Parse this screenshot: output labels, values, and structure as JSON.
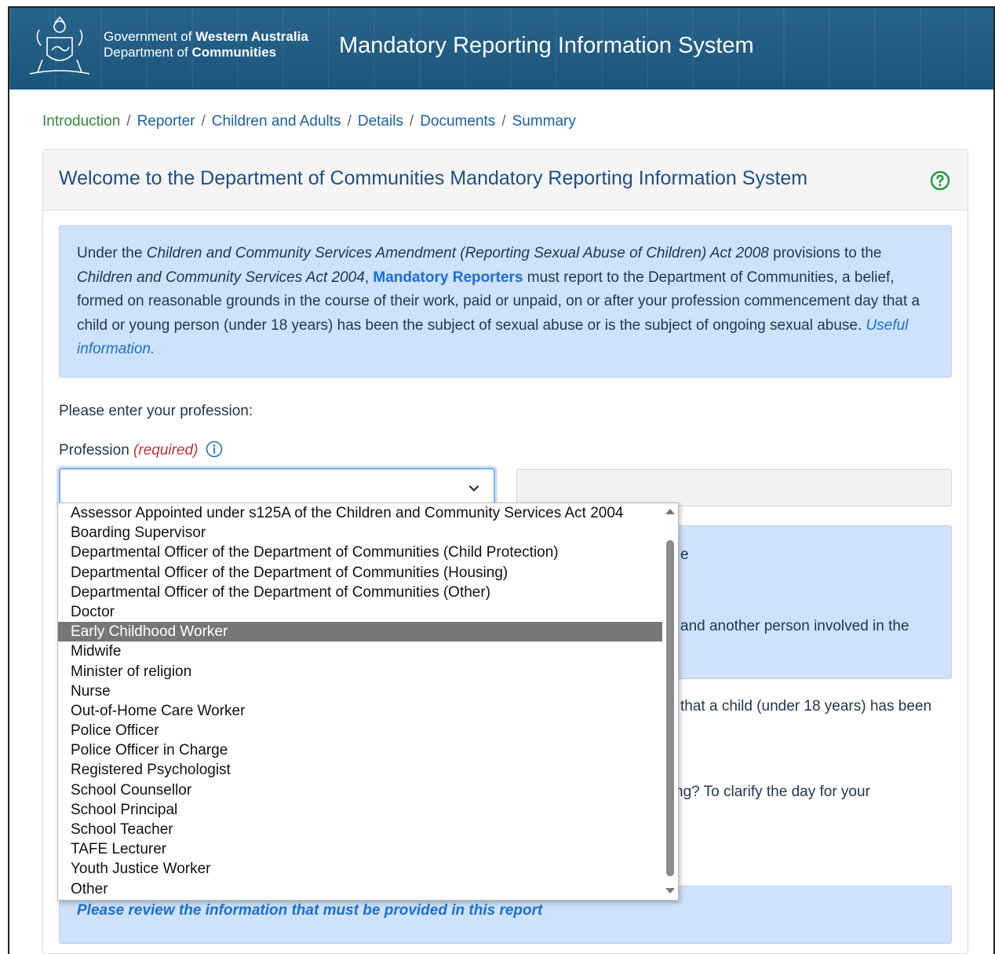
{
  "header": {
    "gov_prefix": "Government of ",
    "gov_strong": "Western Australia",
    "dept_prefix": "Department of ",
    "dept_strong": "Communities",
    "system_title": "Mandatory Reporting Information System"
  },
  "breadcrumb": [
    "Introduction",
    "Reporter",
    "Children and Adults",
    "Details",
    "Documents",
    "Summary"
  ],
  "panel": {
    "title": "Welcome to the Department of Communities Mandatory Reporting Information System"
  },
  "intro": {
    "t1": "Under the ",
    "i1": "Children and Community Services Amendment (Reporting Sexual Abuse of Children) Act 2008",
    "t2": " provisions to the ",
    "i2": "Children and Community Services Act 2004",
    "t3": ", ",
    "link1": "Mandatory Reporters",
    "t4": " must report to the Department of Communities, a belief, formed on reasonable grounds in the course of their work, paid or unpaid, on or after your profession commencement day that a child or young person (under 18 years) has been the subject of sexual abuse or is the subject of ongoing sexual abuse. ",
    "link2": "Useful information."
  },
  "form": {
    "prompt": "Please enter your profession:",
    "profession_label": "Profession ",
    "required_text": "(required)",
    "profession_value": "",
    "other_value": ""
  },
  "partial_text": {
    "p1": "e",
    "p2": "and another person involved in the",
    "p3": "that a child (under 18 years) has been",
    "p4": "ng? To clarify the day for your",
    "review": "Please review the information that must be provided in this report"
  },
  "dropdown": {
    "selected_index": 6,
    "options": [
      "Assessor Appointed under s125A of the Children and Community Services Act 2004",
      "Boarding Supervisor",
      "Departmental Officer of the Department of Communities (Child Protection)",
      "Departmental Officer of the Department of Communities (Housing)",
      "Departmental Officer of the Department of Communities (Other)",
      "Doctor",
      "Early Childhood Worker",
      "Midwife",
      "Minister of religion",
      "Nurse",
      "Out-of-Home Care Worker",
      "Police Officer",
      "Police Officer in Charge",
      "Registered Psychologist",
      "School Counsellor",
      "School Principal",
      "School Teacher",
      "TAFE Lecturer",
      "Youth Justice Worker",
      "Other"
    ]
  },
  "colors": {
    "banner": "#1f5d86",
    "link": "#1a6fd1",
    "breadcrumb_active": "#2f8a3a",
    "info_bg": "#cfe2fb",
    "required": "#c0313b",
    "selected_option": "#767676"
  },
  "icons": {
    "crest": "wa-government-crest-icon",
    "help": "help-circle-icon",
    "info": "info-circle-icon",
    "chevron": "chevron-down-icon"
  }
}
